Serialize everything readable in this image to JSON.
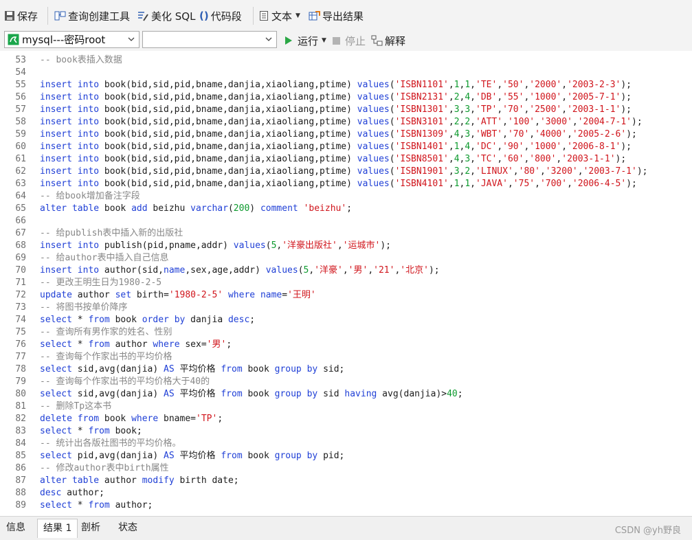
{
  "toolbar": {
    "save": "保存",
    "query_builder": "查询创建工具",
    "beautify": "美化 SQL",
    "snippet": "代码段",
    "text": "文本",
    "export": "导出结果"
  },
  "run_bar": {
    "connection": "mysql---密码root",
    "database": "",
    "run": "运行",
    "stop": "停止",
    "explain": "解释"
  },
  "code_lines": [
    {
      "n": "53",
      "t": [
        [
          "cm",
          "-- book表插入数据"
        ]
      ]
    },
    {
      "n": "54",
      "t": []
    },
    {
      "n": "55",
      "t": [
        [
          "kw",
          "insert into"
        ],
        [
          "pl",
          " book(bid,sid,pid,bname,danjia,xiaoliang,ptime) "
        ],
        [
          "kw",
          "values"
        ],
        [
          "pl",
          "("
        ],
        [
          "str",
          "'ISBN1101'"
        ],
        [
          "pl",
          ","
        ],
        [
          "n",
          "1"
        ],
        [
          "pl",
          ","
        ],
        [
          "n",
          "1"
        ],
        [
          "pl",
          ","
        ],
        [
          "str",
          "'TE'"
        ],
        [
          "pl",
          ","
        ],
        [
          "str",
          "'50'"
        ],
        [
          "pl",
          ","
        ],
        [
          "str",
          "'2000'"
        ],
        [
          "pl",
          ","
        ],
        [
          "str",
          "'2003-2-3'"
        ],
        [
          "pl",
          ");"
        ]
      ]
    },
    {
      "n": "56",
      "t": [
        [
          "kw",
          "insert into"
        ],
        [
          "pl",
          " book(bid,sid,pid,bname,danjia,xiaoliang,ptime) "
        ],
        [
          "kw",
          "values"
        ],
        [
          "pl",
          "("
        ],
        [
          "str",
          "'ISBN2131'"
        ],
        [
          "pl",
          ","
        ],
        [
          "n",
          "2"
        ],
        [
          "pl",
          ","
        ],
        [
          "n",
          "4"
        ],
        [
          "pl",
          ","
        ],
        [
          "str",
          "'DB'"
        ],
        [
          "pl",
          ","
        ],
        [
          "str",
          "'55'"
        ],
        [
          "pl",
          ","
        ],
        [
          "str",
          "'1000'"
        ],
        [
          "pl",
          ","
        ],
        [
          "str",
          "'2005-7-1'"
        ],
        [
          "pl",
          ");"
        ]
      ]
    },
    {
      "n": "57",
      "t": [
        [
          "kw",
          "insert into"
        ],
        [
          "pl",
          " book(bid,sid,pid,bname,danjia,xiaoliang,ptime) "
        ],
        [
          "kw",
          "values"
        ],
        [
          "pl",
          "("
        ],
        [
          "str",
          "'ISBN1301'"
        ],
        [
          "pl",
          ","
        ],
        [
          "n",
          "3"
        ],
        [
          "pl",
          ","
        ],
        [
          "n",
          "3"
        ],
        [
          "pl",
          ","
        ],
        [
          "str",
          "'TP'"
        ],
        [
          "pl",
          ","
        ],
        [
          "str",
          "'70'"
        ],
        [
          "pl",
          ","
        ],
        [
          "str",
          "'2500'"
        ],
        [
          "pl",
          ","
        ],
        [
          "str",
          "'2003-1-1'"
        ],
        [
          "pl",
          ");"
        ]
      ]
    },
    {
      "n": "58",
      "t": [
        [
          "kw",
          "insert into"
        ],
        [
          "pl",
          " book(bid,sid,pid,bname,danjia,xiaoliang,ptime) "
        ],
        [
          "kw",
          "values"
        ],
        [
          "pl",
          "("
        ],
        [
          "str",
          "'ISBN3101'"
        ],
        [
          "pl",
          ","
        ],
        [
          "n",
          "2"
        ],
        [
          "pl",
          ","
        ],
        [
          "n",
          "2"
        ],
        [
          "pl",
          ","
        ],
        [
          "str",
          "'ATT'"
        ],
        [
          "pl",
          ","
        ],
        [
          "str",
          "'100'"
        ],
        [
          "pl",
          ","
        ],
        [
          "str",
          "'3000'"
        ],
        [
          "pl",
          ","
        ],
        [
          "str",
          "'2004-7-1'"
        ],
        [
          "pl",
          ");"
        ]
      ]
    },
    {
      "n": "59",
      "t": [
        [
          "kw",
          "insert into"
        ],
        [
          "pl",
          " book(bid,sid,pid,bname,danjia,xiaoliang,ptime) "
        ],
        [
          "kw",
          "values"
        ],
        [
          "pl",
          "("
        ],
        [
          "str",
          "'ISBN1309'"
        ],
        [
          "pl",
          ","
        ],
        [
          "n",
          "4"
        ],
        [
          "pl",
          ","
        ],
        [
          "n",
          "3"
        ],
        [
          "pl",
          ","
        ],
        [
          "str",
          "'WBT'"
        ],
        [
          "pl",
          ","
        ],
        [
          "str",
          "'70'"
        ],
        [
          "pl",
          ","
        ],
        [
          "str",
          "'4000'"
        ],
        [
          "pl",
          ","
        ],
        [
          "str",
          "'2005-2-6'"
        ],
        [
          "pl",
          ");"
        ]
      ]
    },
    {
      "n": "60",
      "t": [
        [
          "kw",
          "insert into"
        ],
        [
          "pl",
          " book(bid,sid,pid,bname,danjia,xiaoliang,ptime) "
        ],
        [
          "kw",
          "values"
        ],
        [
          "pl",
          "("
        ],
        [
          "str",
          "'ISBN1401'"
        ],
        [
          "pl",
          ","
        ],
        [
          "n",
          "1"
        ],
        [
          "pl",
          ","
        ],
        [
          "n",
          "4"
        ],
        [
          "pl",
          ","
        ],
        [
          "str",
          "'DC'"
        ],
        [
          "pl",
          ","
        ],
        [
          "str",
          "'90'"
        ],
        [
          "pl",
          ","
        ],
        [
          "str",
          "'1000'"
        ],
        [
          "pl",
          ","
        ],
        [
          "str",
          "'2006-8-1'"
        ],
        [
          "pl",
          ");"
        ]
      ]
    },
    {
      "n": "61",
      "t": [
        [
          "kw",
          "insert into"
        ],
        [
          "pl",
          " book(bid,sid,pid,bname,danjia,xiaoliang,ptime) "
        ],
        [
          "kw",
          "values"
        ],
        [
          "pl",
          "("
        ],
        [
          "str",
          "'ISBN8501'"
        ],
        [
          "pl",
          ","
        ],
        [
          "n",
          "4"
        ],
        [
          "pl",
          ","
        ],
        [
          "n",
          "3"
        ],
        [
          "pl",
          ","
        ],
        [
          "str",
          "'TC'"
        ],
        [
          "pl",
          ","
        ],
        [
          "str",
          "'60'"
        ],
        [
          "pl",
          ","
        ],
        [
          "str",
          "'800'"
        ],
        [
          "pl",
          ","
        ],
        [
          "str",
          "'2003-1-1'"
        ],
        [
          "pl",
          ");"
        ]
      ]
    },
    {
      "n": "62",
      "t": [
        [
          "kw",
          "insert into"
        ],
        [
          "pl",
          " book(bid,sid,pid,bname,danjia,xiaoliang,ptime) "
        ],
        [
          "kw",
          "values"
        ],
        [
          "pl",
          "("
        ],
        [
          "str",
          "'ISBN1901'"
        ],
        [
          "pl",
          ","
        ],
        [
          "n",
          "3"
        ],
        [
          "pl",
          ","
        ],
        [
          "n",
          "2"
        ],
        [
          "pl",
          ","
        ],
        [
          "str",
          "'LINUX'"
        ],
        [
          "pl",
          ","
        ],
        [
          "str",
          "'80'"
        ],
        [
          "pl",
          ","
        ],
        [
          "str",
          "'3200'"
        ],
        [
          "pl",
          ","
        ],
        [
          "str",
          "'2003-7-1'"
        ],
        [
          "pl",
          ");"
        ]
      ]
    },
    {
      "n": "63",
      "t": [
        [
          "kw",
          "insert into"
        ],
        [
          "pl",
          " book(bid,sid,pid,bname,danjia,xiaoliang,ptime) "
        ],
        [
          "kw",
          "values"
        ],
        [
          "pl",
          "("
        ],
        [
          "str",
          "'ISBN4101'"
        ],
        [
          "pl",
          ","
        ],
        [
          "n",
          "1"
        ],
        [
          "pl",
          ","
        ],
        [
          "n",
          "1"
        ],
        [
          "pl",
          ","
        ],
        [
          "str",
          "'JAVA'"
        ],
        [
          "pl",
          ","
        ],
        [
          "str",
          "'75'"
        ],
        [
          "pl",
          ","
        ],
        [
          "str",
          "'700'"
        ],
        [
          "pl",
          ","
        ],
        [
          "str",
          "'2006-4-5'"
        ],
        [
          "pl",
          ");"
        ]
      ]
    },
    {
      "n": "64",
      "t": [
        [
          "cm",
          "-- 给book增加备注字段"
        ]
      ]
    },
    {
      "n": "65",
      "t": [
        [
          "kw",
          "alter table"
        ],
        [
          "pl",
          " book "
        ],
        [
          "kw",
          "add"
        ],
        [
          "pl",
          " beizhu "
        ],
        [
          "kw",
          "varchar"
        ],
        [
          "pl",
          "("
        ],
        [
          "n",
          "200"
        ],
        [
          "pl",
          ") "
        ],
        [
          "kw",
          "comment"
        ],
        [
          "pl",
          " "
        ],
        [
          "str",
          "'beizhu'"
        ],
        [
          "pl",
          ";"
        ]
      ]
    },
    {
      "n": "66",
      "t": []
    },
    {
      "n": "67",
      "t": [
        [
          "cm",
          "-- 给publish表中插入新的出版社"
        ]
      ]
    },
    {
      "n": "68",
      "t": [
        [
          "kw",
          "insert into"
        ],
        [
          "pl",
          " publish(pid,pname,addr) "
        ],
        [
          "kw",
          "values"
        ],
        [
          "pl",
          "("
        ],
        [
          "n",
          "5"
        ],
        [
          "pl",
          ","
        ],
        [
          "str",
          "'洋豪出版社'"
        ],
        [
          "pl",
          ","
        ],
        [
          "str",
          "'运城市'"
        ],
        [
          "pl",
          ");"
        ]
      ]
    },
    {
      "n": "69",
      "t": [
        [
          "cm",
          "-- 给author表中插入自己信息"
        ]
      ]
    },
    {
      "n": "70",
      "t": [
        [
          "kw",
          "insert into"
        ],
        [
          "pl",
          " author(sid,"
        ],
        [
          "kw",
          "name"
        ],
        [
          "pl",
          ",sex,age,addr) "
        ],
        [
          "kw",
          "values"
        ],
        [
          "pl",
          "("
        ],
        [
          "n",
          "5"
        ],
        [
          "pl",
          ","
        ],
        [
          "str",
          "'洋豪'"
        ],
        [
          "pl",
          ","
        ],
        [
          "str",
          "'男'"
        ],
        [
          "pl",
          ","
        ],
        [
          "str",
          "'21'"
        ],
        [
          "pl",
          ","
        ],
        [
          "str",
          "'北京'"
        ],
        [
          "pl",
          ");"
        ]
      ]
    },
    {
      "n": "71",
      "t": [
        [
          "cm",
          "-- 更改王明生日为1980-2-5"
        ]
      ]
    },
    {
      "n": "72",
      "t": [
        [
          "kw",
          "update"
        ],
        [
          "pl",
          " author "
        ],
        [
          "kw",
          "set"
        ],
        [
          "pl",
          " birth="
        ],
        [
          "str",
          "'1980-2-5'"
        ],
        [
          "pl",
          " "
        ],
        [
          "kw",
          "where"
        ],
        [
          "pl",
          " "
        ],
        [
          "kw",
          "name"
        ],
        [
          "pl",
          "="
        ],
        [
          "str",
          "'王明'"
        ]
      ]
    },
    {
      "n": "73",
      "t": [
        [
          "cm",
          "-- 将图书按单价降序"
        ]
      ]
    },
    {
      "n": "74",
      "t": [
        [
          "kw",
          "select"
        ],
        [
          "pl",
          " * "
        ],
        [
          "kw",
          "from"
        ],
        [
          "pl",
          " book "
        ],
        [
          "kw",
          "order by"
        ],
        [
          "pl",
          " danjia "
        ],
        [
          "kw",
          "desc"
        ],
        [
          "pl",
          ";"
        ]
      ]
    },
    {
      "n": "75",
      "t": [
        [
          "cm",
          "-- 查询所有男作家的姓名、性别"
        ]
      ]
    },
    {
      "n": "76",
      "t": [
        [
          "kw",
          "select"
        ],
        [
          "pl",
          " * "
        ],
        [
          "kw",
          "from"
        ],
        [
          "pl",
          " author "
        ],
        [
          "kw",
          "where"
        ],
        [
          "pl",
          " sex="
        ],
        [
          "str",
          "'男'"
        ],
        [
          "pl",
          ";"
        ]
      ]
    },
    {
      "n": "77",
      "t": [
        [
          "cm",
          "-- 查询每个作家出书的平均价格"
        ]
      ]
    },
    {
      "n": "78",
      "t": [
        [
          "kw",
          "select"
        ],
        [
          "pl",
          " sid,avg(danjia) "
        ],
        [
          "kw",
          "AS"
        ],
        [
          "pl",
          " 平均价格 "
        ],
        [
          "kw",
          "from"
        ],
        [
          "pl",
          " book "
        ],
        [
          "kw",
          "group by"
        ],
        [
          "pl",
          " sid;"
        ]
      ]
    },
    {
      "n": "79",
      "t": [
        [
          "cm",
          "-- 查询每个作家出书的平均价格大于40的"
        ]
      ]
    },
    {
      "n": "80",
      "t": [
        [
          "kw",
          "select"
        ],
        [
          "pl",
          " sid,avg(danjia) "
        ],
        [
          "kw",
          "AS"
        ],
        [
          "pl",
          " 平均价格 "
        ],
        [
          "kw",
          "from"
        ],
        [
          "pl",
          " book "
        ],
        [
          "kw",
          "group by"
        ],
        [
          "pl",
          " sid "
        ],
        [
          "kw",
          "having"
        ],
        [
          "pl",
          " avg(danjia)>"
        ],
        [
          "n",
          "40"
        ],
        [
          "pl",
          ";"
        ]
      ]
    },
    {
      "n": "81",
      "t": [
        [
          "cm",
          "-- 删除Tp这本书"
        ]
      ]
    },
    {
      "n": "82",
      "t": [
        [
          "kw",
          "delete from"
        ],
        [
          "pl",
          " book "
        ],
        [
          "kw",
          "where"
        ],
        [
          "pl",
          " bname="
        ],
        [
          "str",
          "'TP'"
        ],
        [
          "pl",
          ";"
        ]
      ]
    },
    {
      "n": "83",
      "t": [
        [
          "kw",
          "select"
        ],
        [
          "pl",
          " * "
        ],
        [
          "kw",
          "from"
        ],
        [
          "pl",
          " book;"
        ]
      ]
    },
    {
      "n": "84",
      "t": [
        [
          "cm",
          "-- 统计出各版社图书的平均价格。"
        ]
      ]
    },
    {
      "n": "85",
      "t": [
        [
          "kw",
          "select"
        ],
        [
          "pl",
          " pid,avg(danjia) "
        ],
        [
          "kw",
          "AS"
        ],
        [
          "pl",
          " 平均价格 "
        ],
        [
          "kw",
          "from"
        ],
        [
          "pl",
          " book "
        ],
        [
          "kw",
          "group by"
        ],
        [
          "pl",
          " pid;"
        ]
      ]
    },
    {
      "n": "86",
      "t": [
        [
          "cm",
          "-- 修改author表中birth属性"
        ]
      ]
    },
    {
      "n": "87",
      "t": [
        [
          "kw",
          "alter table"
        ],
        [
          "pl",
          " author "
        ],
        [
          "kw",
          "modify"
        ],
        [
          "pl",
          " birth date;"
        ]
      ]
    },
    {
      "n": "88",
      "t": [
        [
          "kw",
          "desc"
        ],
        [
          "pl",
          " author;"
        ]
      ]
    },
    {
      "n": "89",
      "t": [
        [
          "kw",
          "select"
        ],
        [
          "pl",
          " * "
        ],
        [
          "kw",
          "from"
        ],
        [
          "pl",
          " author;"
        ]
      ]
    }
  ],
  "bottom_tabs": [
    "信息",
    "结果 1",
    "剖析",
    "状态"
  ],
  "watermark": "CSDN @yh野良",
  "colors": {
    "keyword": "#1f3fd6",
    "string": "#d0141b",
    "number": "#0d9a2e",
    "comment": "#878787",
    "run_icon": "#2aa745"
  }
}
